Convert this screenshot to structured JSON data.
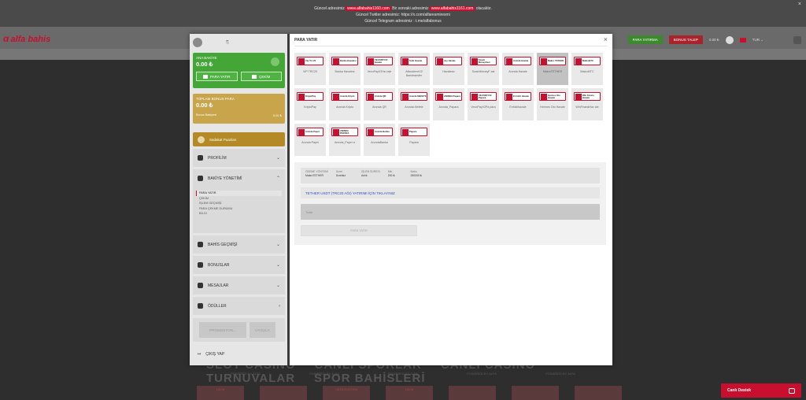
{
  "announcement": {
    "line1_pre": "Güncel adresimiz",
    "line1_link1": "www.alfabahis1160.com",
    "line1_mid": "Bir sonraki adresimiz",
    "line1_link2": "www.alfabahis1161.com",
    "line1_post": "olacaktır.",
    "line2": "Güncel Twitter adresimiz: https://x.com/alfaresmiresmi",
    "line3": "Güncel Telegram adresimiz : t.me/alfabonus",
    "close": "×"
  },
  "header": {
    "brand": "alfa bahis",
    "brand_mark": "α",
    "deposit_btn": "PARA YATIRMA",
    "bonus_btn": "BONUS TALEP",
    "balance": "0.00 ₺",
    "lang": "TUR ⌄"
  },
  "background": {
    "hero": [
      "SLOT CASINO",
      "CANLI SPORLAR",
      "CANLI CASINO",
      "TURNUVALAR",
      "SPOR BAHİSLERİ"
    ],
    "powered": [
      "POWERED BY ALFA",
      "POWERED BY ALFA",
      "POWERED BY ALFA",
      "POWERED BY ALFA",
      "POWERED BY ALFA"
    ],
    "cards": [
      "UEFA",
      "",
      "UEFA EUROPA",
      "UEFA",
      "",
      "",
      ""
    ]
  },
  "live_support": {
    "label": "Canlı Destek"
  },
  "sidebar": {
    "main_balance_label": "ANA BAKİYE",
    "main_balance_value": "0.00 ₺",
    "deposit_label": "PARA YATIR",
    "withdraw_label": "ÇEKİM",
    "bonus_label": "TOPLAM BONUS PARA",
    "bonus_value": "0.00 ₺",
    "bonus_sub_label": "Bonus Bakiyesi",
    "bonus_sub_value": "0.00 ₺",
    "loyalty_label": "Sadakat Puanları",
    "profile": "PROFİLİM",
    "balance_mgmt": "BAKİYE YÖNETİMİ",
    "submenu": [
      "PARA YATIR",
      "ÇEKİM",
      "İŞLEM GEÇMİŞİ",
      "PARA ÇEKME DURUMU",
      "BİLGİ"
    ],
    "bet_history": "BAHİS GEÇMİŞİ",
    "bonuses": "BONUSLAR",
    "messages": "MESAJLAR",
    "rewards": "ÖDÜLLER",
    "promo_placeholder": "PROMOSYON...",
    "promo_btn": "UYGULA",
    "logout": "ÇIKIŞ YAP"
  },
  "main": {
    "title": "PARA YATIR",
    "close": "×",
    "methods": [
      {
        "logo": "Vip Trc 20",
        "name": "VIP TRC20"
      },
      {
        "logo": "Banka Havalesi",
        "name": "Banka Havalesi"
      },
      {
        "logo": "VEVOPAYV2 Havale",
        "name": "VevoPayV2Ha vale"
      },
      {
        "logo": "Sofir Havale",
        "name": "AlfaodemeV2 Banktransfer"
      },
      {
        "logo": "Joy Havale",
        "name": "Havalesiz"
      },
      {
        "logo": "Scash MoneyFast",
        "name": "ScashMoneyF ast"
      },
      {
        "logo": "Anında Havale",
        "name": "Anında Havale"
      },
      {
        "logo": "Makro TETHER",
        "name": "MakroTETHER"
      },
      {
        "logo": "MakroBTC",
        "name": "MakroBTC"
      },
      {
        "logo": "KriptoPay",
        "name": "KriptoPay"
      },
      {
        "logo": "Anında Kripto",
        "name": "Anında Kripto"
      },
      {
        "logo": "Anında QR",
        "name": "Anında QR"
      },
      {
        "logo": "Anında MEFETE",
        "name": "Anında Mefete"
      },
      {
        "logo": "ANINDA Papara",
        "name": "Anında_Papara"
      },
      {
        "logo": "VEVOPAYV2 Papara",
        "name": "VevoPayV2Pa para"
      },
      {
        "logo": "En Hızlı Havale",
        "name": "Enhizlihavale"
      },
      {
        "logo": "Hermes Oto Havale",
        "name": "Hermes Oto Havale"
      },
      {
        "logo": "Win Finans Havale",
        "name": "WinFinansHav ale"
      },
      {
        "logo": "Anında Papel",
        "name": "Anında Papel"
      },
      {
        "logo": "ANINDA PAPARA",
        "name": "Anında_Paper a"
      },
      {
        "logo": "Anında Banka",
        "name": "AnındaBanka"
      },
      {
        "logo": "Papara",
        "name": "Papara"
      }
    ],
    "selected_index": 7,
    "info": {
      "method_label": "ÖDEME YÖNTEMİ",
      "method_value": "MakroTETHER",
      "fee_label": "Ücret",
      "fee_value": "Ücretsiz",
      "time_label": "İŞLEM SÜRESİ",
      "time_value": "Anlık",
      "min_label": "Min.",
      "min_value": "200 ₺",
      "max_label": "Maks.",
      "max_value": "250000 ₺"
    },
    "tether_link": "TETHER USDT (TRC20 AĞI) YATIRIMI İÇİN TIKLAYINIZ",
    "amount_placeholder": "Tutar",
    "submit": "PARA YATIR"
  }
}
